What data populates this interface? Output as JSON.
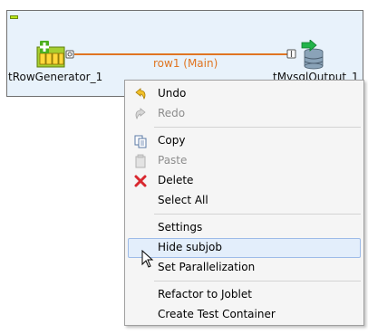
{
  "canvas": {
    "components": [
      {
        "label": "tRowGenerator_1",
        "icon": "row-generator-icon"
      },
      {
        "label": "tMysqlOutput_1",
        "icon": "mysql-output-icon"
      }
    ],
    "connection": {
      "label": "row1 (Main)"
    }
  },
  "context_menu": {
    "items": [
      {
        "label": "Undo",
        "icon": "undo-icon",
        "enabled": true
      },
      {
        "label": "Redo",
        "icon": "redo-icon",
        "enabled": false
      },
      {
        "label": "Copy",
        "icon": "copy-icon",
        "enabled": true
      },
      {
        "label": "Paste",
        "icon": "paste-icon",
        "enabled": false
      },
      {
        "label": "Delete",
        "icon": "delete-icon",
        "enabled": true
      },
      {
        "label": "Select All",
        "enabled": true
      },
      {
        "label": "Settings",
        "enabled": true
      },
      {
        "label": "Hide subjob",
        "enabled": true,
        "highlighted": true
      },
      {
        "label": "Set Parallelization",
        "enabled": true
      },
      {
        "label": "Refactor to Joblet",
        "enabled": true
      },
      {
        "label": "Create Test Container",
        "enabled": true
      }
    ]
  },
  "colors": {
    "subjob_background": "#e8f2fb",
    "connection": "#e07522",
    "highlight": "#e3eefb",
    "disabled_text": "#8d8d8d"
  }
}
